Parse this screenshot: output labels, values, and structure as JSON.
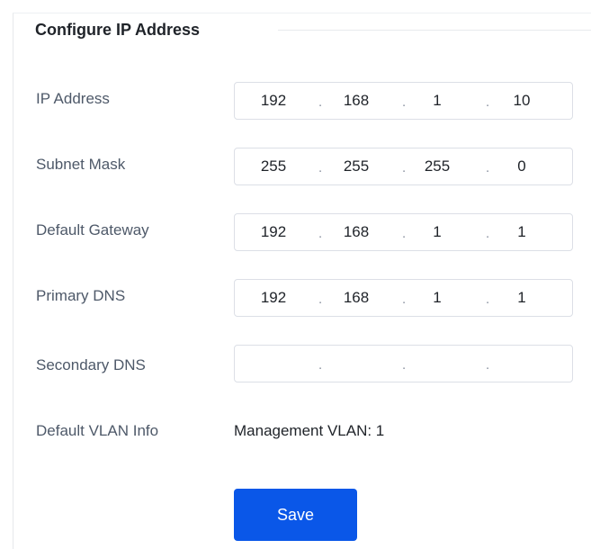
{
  "section": {
    "title": "Configure IP Address"
  },
  "fields": {
    "ip_address": {
      "label": "IP Address",
      "octets": [
        "192",
        "168",
        "1",
        "10"
      ]
    },
    "subnet_mask": {
      "label": "Subnet Mask",
      "octets": [
        "255",
        "255",
        "255",
        "0"
      ]
    },
    "default_gateway": {
      "label": "Default Gateway",
      "octets": [
        "192",
        "168",
        "1",
        "1"
      ]
    },
    "primary_dns": {
      "label": "Primary DNS",
      "octets": [
        "192",
        "168",
        "1",
        "1"
      ]
    },
    "secondary_dns": {
      "label": "Secondary DNS",
      "octets": [
        "",
        "",
        "",
        ""
      ]
    }
  },
  "vlan": {
    "label": "Default VLAN Info",
    "value": "Management VLAN: 1"
  },
  "actions": {
    "save_label": "Save"
  },
  "colors": {
    "primary_button": "#0a57e8",
    "label_text": "#4e5969",
    "value_text": "#1f2329",
    "input_border": "#dcdfe6"
  }
}
